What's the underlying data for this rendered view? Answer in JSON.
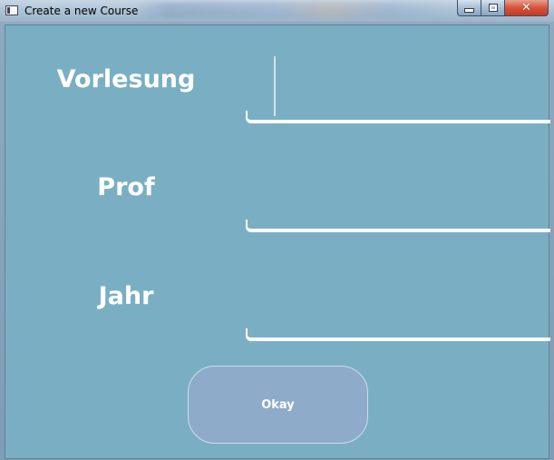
{
  "window": {
    "title": "Create a new Course",
    "controls": {
      "minimize_icon": "minimize-icon",
      "maximize_icon": "maximize-icon",
      "close_icon": "close-icon",
      "close_glyph": "✕"
    }
  },
  "form": {
    "fields": [
      {
        "label": "Vorlesung",
        "value": "",
        "focused": true
      },
      {
        "label": "Prof",
        "value": ""
      },
      {
        "label": "Jahr",
        "value": ""
      }
    ],
    "submit_label": "Okay"
  },
  "colors": {
    "background": "#7aafc3",
    "button": "#8eabc9",
    "text": "#ffffff",
    "close_button": "#c43a22"
  }
}
